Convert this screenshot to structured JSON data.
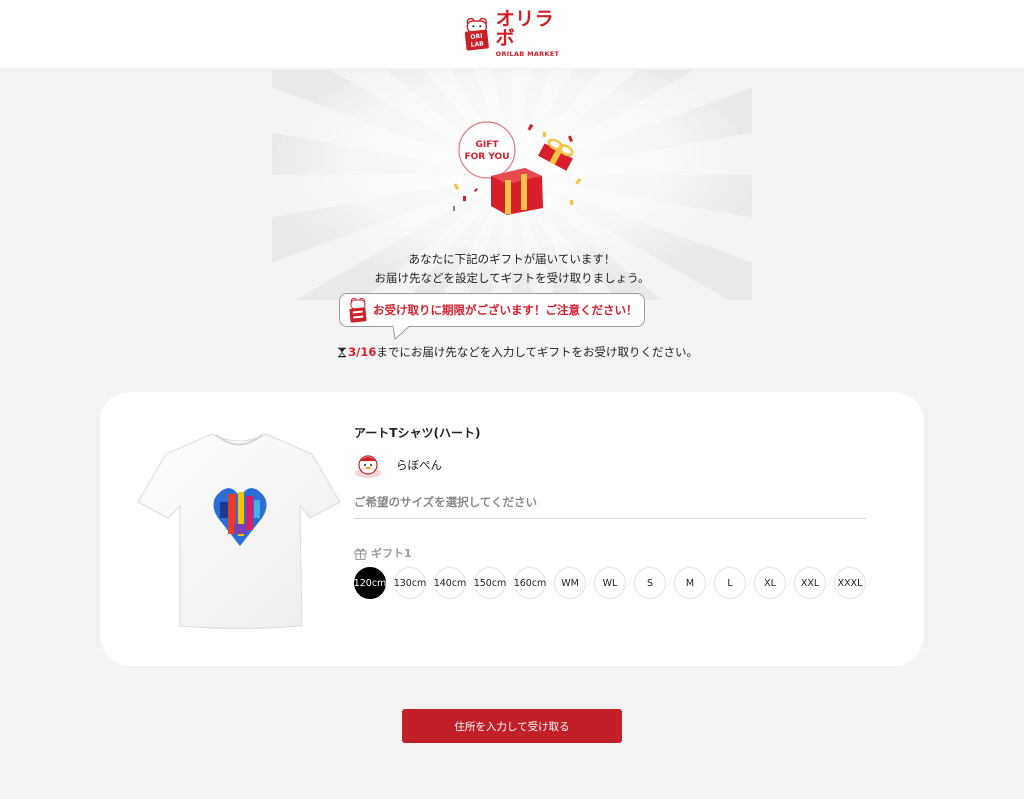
{
  "header": {
    "logo_jp": "オリラボ",
    "logo_en": "ORILAB MARKET",
    "badge_top": "ORI",
    "badge_bottom": "LAB"
  },
  "gift": {
    "bubble_line1": "GIFT",
    "bubble_line2": "FOR YOU"
  },
  "intro": {
    "line1": "あなたに下記のギフトが届いています！",
    "line2": "お届け先などを設定してギフトを受け取りましょう。"
  },
  "notice": {
    "text": "お受け取りに期限がございます！ご注意ください！"
  },
  "deadline": {
    "date": "3/16",
    "text": "までにお届け先などを入力してギフトをお受け取りください。"
  },
  "product": {
    "title": "アートTシャツ(ハート)",
    "creator": "らぼぺん",
    "size_prompt": "ご希望のサイズを選択してください",
    "gift_label": "ギフト1",
    "sizes": [
      "120cm",
      "130cm",
      "140cm",
      "150cm",
      "160cm",
      "WM",
      "WL",
      "S",
      "M",
      "L",
      "XL",
      "XXL",
      "XXXL"
    ],
    "selected_size": "120cm"
  },
  "actions": {
    "submit_label": "住所を入力して受け取る"
  },
  "colors": {
    "brand_red": "#c22027",
    "alert_red": "#d81e2a",
    "background": "#f3f3f3"
  }
}
